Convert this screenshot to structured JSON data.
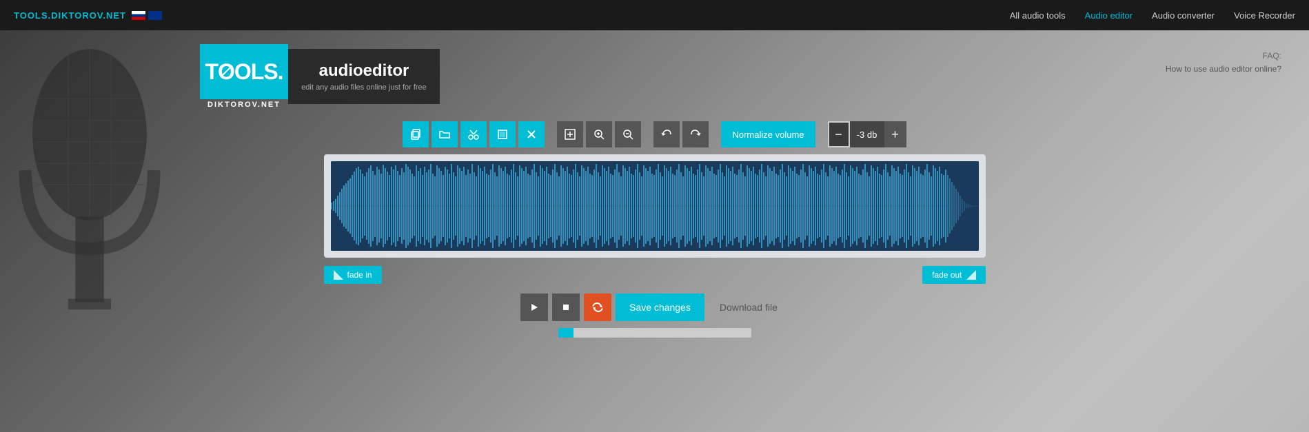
{
  "site": {
    "logo_text": "TOOLS.",
    "logo_sub": "DIKTOROV.NET",
    "domain_display": "TOOLS.DIKTOROV.NET"
  },
  "nav": {
    "links": [
      {
        "label": "All audio tools",
        "active": false
      },
      {
        "label": "Audio editor",
        "active": true
      },
      {
        "label": "Audio converter",
        "active": false
      },
      {
        "label": "Voice Recorder",
        "active": false
      }
    ]
  },
  "audio_editor_banner": {
    "title_light": "audio",
    "title_bold": "editor",
    "subtitle": "edit any audio files online just for free"
  },
  "faq": {
    "label": "FAQ:",
    "link_text": "How to use audio editor online?"
  },
  "toolbar": {
    "buttons": [
      {
        "id": "copy",
        "icon": "⧉",
        "title": "Copy"
      },
      {
        "id": "open",
        "icon": "📁",
        "title": "Open file"
      },
      {
        "id": "cut",
        "icon": "✂",
        "title": "Cut"
      },
      {
        "id": "crop",
        "icon": "⊡",
        "title": "Crop"
      },
      {
        "id": "delete",
        "icon": "✕",
        "title": "Delete"
      }
    ],
    "zoom_buttons": [
      {
        "id": "zoom-fit",
        "icon": "⛶",
        "title": "Fit"
      },
      {
        "id": "zoom-in",
        "icon": "🔍+",
        "title": "Zoom in"
      },
      {
        "id": "zoom-out",
        "icon": "🔍-",
        "title": "Zoom out"
      }
    ],
    "undo_redo": [
      {
        "id": "undo",
        "icon": "↩",
        "title": "Undo"
      },
      {
        "id": "redo",
        "icon": "↪",
        "title": "Redo"
      }
    ],
    "normalize_label": "Normalize volume",
    "volume_minus": "−",
    "volume_db": "-3 db",
    "volume_plus": "+"
  },
  "fade": {
    "fade_in_label": "fade in",
    "fade_out_label": "fade out"
  },
  "playback": {
    "play_icon": "▶",
    "stop_icon": "■",
    "refresh_icon": "↺",
    "save_changes_label": "Save changes",
    "download_label": "Download file"
  },
  "colors": {
    "cyan": "#00bcd4",
    "dark_nav": "#1a1a1a",
    "orange_refresh": "#e05020",
    "waveform_bg": "#1a3a5c",
    "waveform_fill": "#3aa0cc"
  }
}
